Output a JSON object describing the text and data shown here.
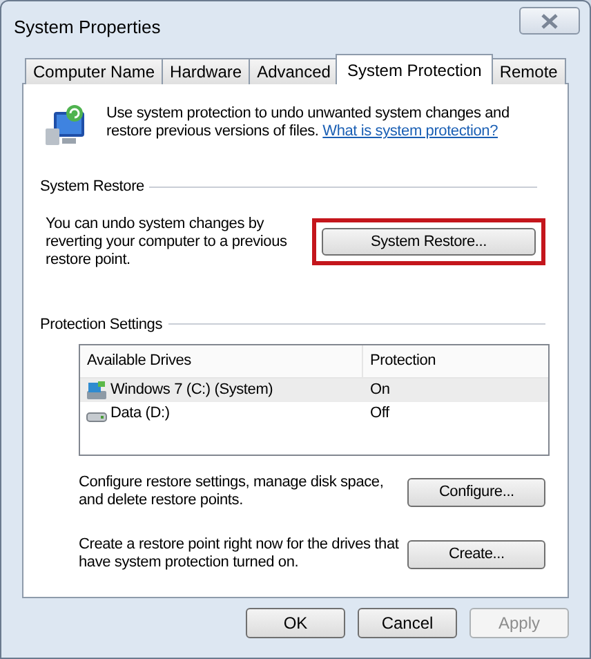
{
  "window": {
    "title": "System Properties"
  },
  "tabs": [
    {
      "label": "Computer Name",
      "selected": false
    },
    {
      "label": "Hardware",
      "selected": false
    },
    {
      "label": "Advanced",
      "selected": false
    },
    {
      "label": "System Protection",
      "selected": true
    },
    {
      "label": "Remote",
      "selected": false
    }
  ],
  "intro": {
    "text": "Use system protection to undo unwanted system changes and restore previous versions of files.",
    "link": "What is system protection?"
  },
  "system_restore": {
    "heading": "System Restore",
    "text": "You can undo system changes by reverting your computer to a previous restore point.",
    "button": {
      "label": "System Restore...",
      "highlighted": true
    }
  },
  "protection_settings": {
    "heading": "Protection Settings",
    "table": {
      "columns": [
        "Available Drives",
        "Protection"
      ],
      "rows": [
        {
          "drive": "Windows 7 (C:) (System)",
          "kind": "system",
          "protection": "On",
          "selected": true
        },
        {
          "drive": "Data (D:)",
          "kind": "data",
          "protection": "Off",
          "selected": false
        }
      ]
    },
    "configure": {
      "text": "Configure restore settings, manage disk space, and delete restore points.",
      "button": "Configure..."
    },
    "create": {
      "text": "Create a restore point right now for the drives that have system protection turned on.",
      "button": "Create..."
    }
  },
  "buttons": [
    {
      "label": "OK",
      "disabled": false
    },
    {
      "label": "Cancel",
      "disabled": false
    },
    {
      "label": "Apply",
      "disabled": true
    }
  ]
}
